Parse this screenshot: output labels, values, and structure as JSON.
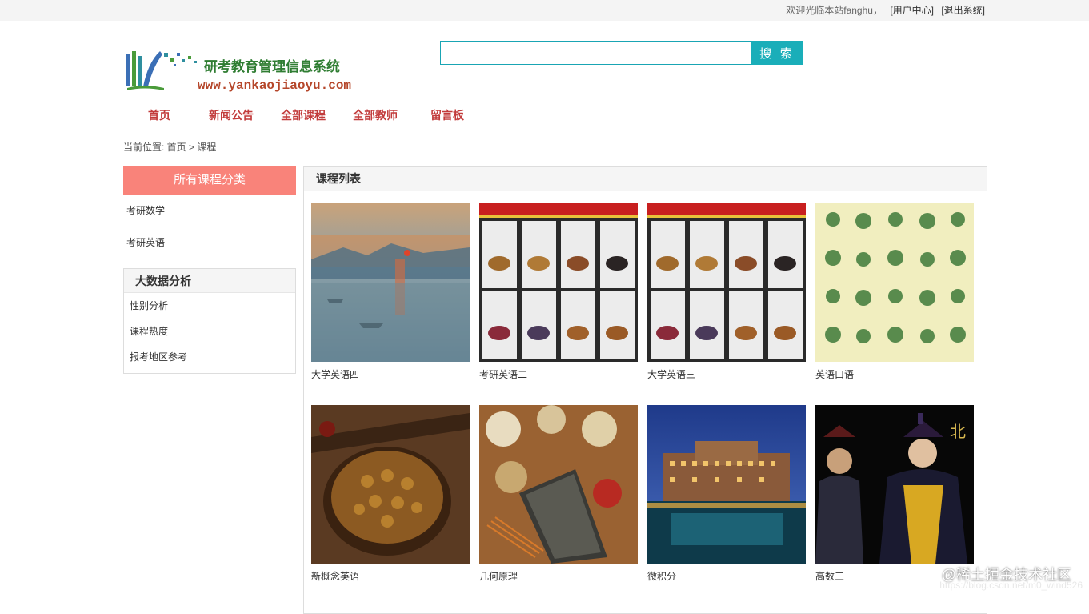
{
  "topbar": {
    "welcome": "欢迎光临本站fanghu，",
    "user_center": "[用户中心]",
    "logout": "[退出系统]"
  },
  "logo": {
    "title": "研考教育管理信息系统",
    "url": "www.yankaojiaoyu.com",
    "icon": "books-logo-icon"
  },
  "search": {
    "value": "",
    "placeholder": "",
    "button_label": "搜 索"
  },
  "nav": {
    "items": [
      "首页",
      "新闻公告",
      "全部课程",
      "全部教师",
      "留言板"
    ]
  },
  "breadcrumb": {
    "text": "当前位置: 首页 >  课程"
  },
  "sidebar": {
    "category_header": "所有课程分类",
    "categories": [
      "考研数学",
      "考研英语"
    ],
    "bigdata": {
      "header": "大数据分析",
      "items": [
        "性别分析",
        "课程热度",
        "报考地区参考"
      ]
    }
  },
  "main": {
    "header": "课程列表",
    "courses": [
      {
        "name": "大学英语四",
        "image": "sunrise-painting"
      },
      {
        "name": "考研英语二",
        "image": "herbal-poster"
      },
      {
        "name": "大学英语三",
        "image": "herbal-poster"
      },
      {
        "name": "英语口语",
        "image": "herb-illustrations"
      },
      {
        "name": "新概念英语",
        "image": "herb-bowl"
      },
      {
        "name": "几何原理",
        "image": "herb-book"
      },
      {
        "name": "微积分",
        "image": "hotel-night"
      },
      {
        "name": "高数三",
        "image": "opera-performer"
      }
    ]
  },
  "watermark": {
    "text": "@稀土掘金技术社区",
    "url": "https://blog.csdn.net/m0_wind526"
  },
  "colors": {
    "accent_teal": "#1aaeb9",
    "nav_red": "#c23b3b",
    "category_header": "#f9837a"
  }
}
